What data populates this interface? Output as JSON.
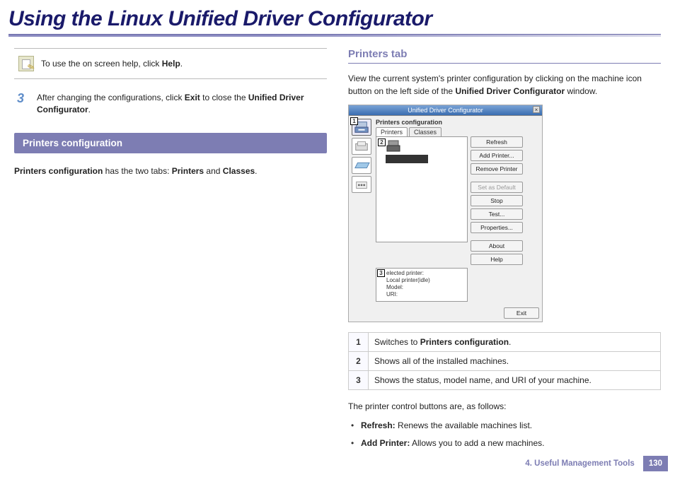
{
  "page_title": "Using the Linux Unified Driver Configurator",
  "tip": {
    "prefix": "To use the on screen help, click ",
    "bold": "Help",
    "suffix": "."
  },
  "step": {
    "number": "3",
    "prefix": "After changing the configurations, click ",
    "bold1": "Exit",
    "mid": " to close the ",
    "bold2": "Unified Driver Configurator",
    "suffix": "."
  },
  "section_bar": "Printers configuration",
  "section_intro": {
    "bold1": "Printers configuration",
    "mid": " has the two tabs: ",
    "bold2": "Printers",
    "mid2": " and ",
    "bold3": "Classes",
    "suffix": "."
  },
  "right": {
    "sub_head": "Printers tab",
    "intro_prefix": "View the current system's printer configuration by clicking on the machine icon button on the left side of the ",
    "intro_bold": "Unified Driver Configurator",
    "intro_suffix": " window."
  },
  "screenshot": {
    "window_title": "Unified Driver Configurator",
    "inner_title": "Printers configuration",
    "tabs": [
      "Printers",
      "Classes"
    ],
    "callouts": {
      "c1": "1",
      "c2": "2",
      "c3": "3"
    },
    "buttons": {
      "refresh": "Refresh",
      "add": "Add Printer...",
      "remove": "Remove Printer",
      "default": "Set as Default",
      "stop": "Stop",
      "test": "Test...",
      "properties": "Properties...",
      "about": "About",
      "help": "Help"
    },
    "selinfo": {
      "head": "elected printer:",
      "line1": "Local printer(idle)",
      "line2": "Model:",
      "line3": "URI:"
    },
    "exit": "Exit"
  },
  "legend": {
    "r1_num": "1",
    "r1_prefix": "Switches to ",
    "r1_bold": "Printers configuration",
    "r1_suffix": ".",
    "r2_num": "2",
    "r2_text": "Shows all of the installed machines.",
    "r3_num": "3",
    "r3_text": "Shows the status, model name, and URI of your machine."
  },
  "control_intro": "The printer control buttons are, as follows:",
  "bullets": {
    "b1_bold": "Refresh:",
    "b1_text": " Renews the available machines list.",
    "b2_bold": "Add Printer:",
    "b2_text": " Allows you to add a new machines."
  },
  "footer": {
    "chapter": "4.  Useful Management Tools",
    "page": "130"
  }
}
